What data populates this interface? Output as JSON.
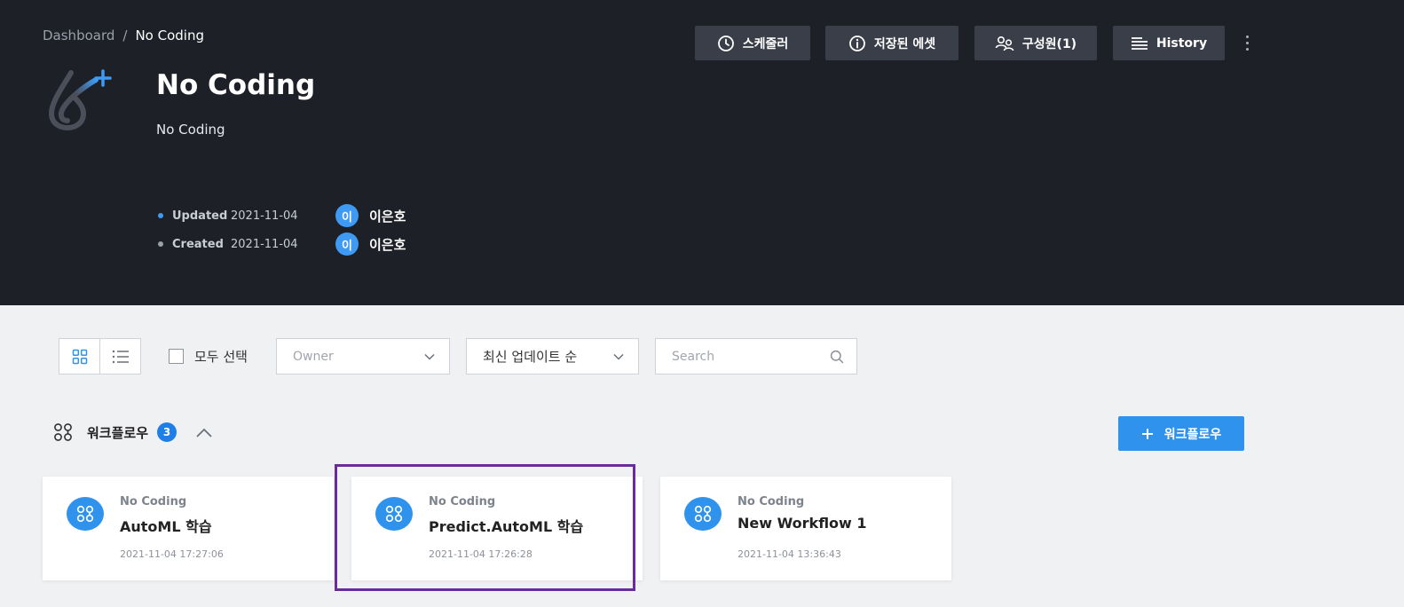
{
  "breadcrumb": {
    "root": "Dashboard",
    "separator": "/",
    "current": "No Coding"
  },
  "project": {
    "title": "No Coding",
    "description": "No Coding",
    "logo_icon": "drop-sparkle-logo"
  },
  "meta": {
    "updated_label": "Updated",
    "updated_date": "2021-11-04",
    "updated_avatar": "이",
    "updated_user": "이은호",
    "created_label": "Created",
    "created_date": "2021-11-04",
    "created_avatar": "이",
    "created_user": "이은호"
  },
  "header_buttons": {
    "scheduler": "스케줄러",
    "saved_assets": "저장된 에셋",
    "members": "구성원(1)",
    "history": "History"
  },
  "toolbar": {
    "select_all": "모두 선택",
    "owner_placeholder": "Owner",
    "sort_value": "최신 업데이트 순",
    "search_placeholder": "Search"
  },
  "section": {
    "title": "워크플로우",
    "count": "3",
    "add_button": "워크플로우"
  },
  "workflows": [
    {
      "project": "No Coding",
      "name": "AutoML 학습",
      "date": "2021-11-04 17:27:06"
    },
    {
      "project": "No Coding",
      "name": "Predict.AutoML 학습",
      "date": "2021-11-04 17:26:28"
    },
    {
      "project": "No Coding",
      "name": "New Workflow 1",
      "date": "2021-11-04 13:36:43"
    }
  ],
  "colors": {
    "header_bg": "#1e2028",
    "accent": "#2f93ee",
    "badge": "#1f7fe8",
    "highlight": "#6a2c9b"
  }
}
